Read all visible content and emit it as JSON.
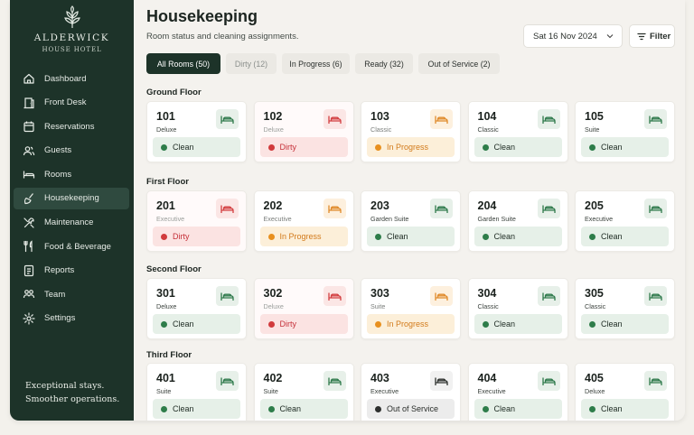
{
  "brand": {
    "name": "ALDERWICK",
    "sub": "HOUSE HOTEL"
  },
  "nav": [
    {
      "label": "Dashboard",
      "icon": "home-icon",
      "active": false
    },
    {
      "label": "Front Desk",
      "icon": "door-icon",
      "active": false
    },
    {
      "label": "Reservations",
      "icon": "calendar-icon",
      "active": false
    },
    {
      "label": "Guests",
      "icon": "users-icon",
      "active": false
    },
    {
      "label": "Rooms",
      "icon": "bed-icon",
      "active": false
    },
    {
      "label": "Housekeeping",
      "icon": "broom-icon",
      "active": true
    },
    {
      "label": "Maintenance",
      "icon": "tools-icon",
      "active": false
    },
    {
      "label": "Food & Beverage",
      "icon": "cutlery-icon",
      "active": false
    },
    {
      "label": "Reports",
      "icon": "report-icon",
      "active": false
    },
    {
      "label": "Team",
      "icon": "team-icon",
      "active": false
    },
    {
      "label": "Settings",
      "icon": "gear-icon",
      "active": false
    }
  ],
  "tagline": {
    "line1": "Exceptional stays.",
    "line2": "Smoother operations."
  },
  "header": {
    "title": "Housekeeping",
    "subtitle": "Room status and cleaning assignments."
  },
  "date_label": "Sat 16 Nov 2024",
  "filter_label": "Filter",
  "tabs": [
    {
      "label": "All Rooms (50)",
      "state": "active"
    },
    {
      "label": "Dirty (12)",
      "state": "muted"
    },
    {
      "label": "In Progress (6)",
      "state": "normal"
    },
    {
      "label": "Ready (32)",
      "state": "normal"
    },
    {
      "label": "Out of Service (2)",
      "state": "normal"
    }
  ],
  "colors": {
    "sidebar": "#1d3329",
    "clean": "#2e7d4a",
    "dirty": "#d13a3c",
    "in_progress": "#e8901f",
    "out_of_service": "#2d2f2e"
  },
  "floors": [
    {
      "name": "Ground Floor",
      "rooms": [
        {
          "number": "101",
          "type": "Deluxe",
          "status": "Clean",
          "kind": "clean"
        },
        {
          "number": "102",
          "type": "Deluxe",
          "status": "Dirty",
          "kind": "dirty"
        },
        {
          "number": "103",
          "type": "Classic",
          "status": "In Progress",
          "kind": "prog"
        },
        {
          "number": "104",
          "type": "Classic",
          "status": "Clean",
          "kind": "clean"
        },
        {
          "number": "105",
          "type": "Suite",
          "status": "Clean",
          "kind": "clean"
        }
      ]
    },
    {
      "name": "First Floor",
      "rooms": [
        {
          "number": "201",
          "type": "Executive",
          "status": "Dirty",
          "kind": "dirty"
        },
        {
          "number": "202",
          "type": "Executive",
          "status": "In Progress",
          "kind": "prog"
        },
        {
          "number": "203",
          "type": "Garden Suite",
          "status": "Clean",
          "kind": "clean"
        },
        {
          "number": "204",
          "type": "Garden Suite",
          "status": "Clean",
          "kind": "clean"
        },
        {
          "number": "205",
          "type": "Executive",
          "status": "Clean",
          "kind": "clean"
        }
      ]
    },
    {
      "name": "Second Floor",
      "rooms": [
        {
          "number": "301",
          "type": "Deluxe",
          "status": "Clean",
          "kind": "clean"
        },
        {
          "number": "302",
          "type": "Deluxe",
          "status": "Dirty",
          "kind": "dirty"
        },
        {
          "number": "303",
          "type": "Suite",
          "status": "In Progress",
          "kind": "prog"
        },
        {
          "number": "304",
          "type": "Classic",
          "status": "Clean",
          "kind": "clean"
        },
        {
          "number": "305",
          "type": "Classic",
          "status": "Clean",
          "kind": "clean"
        }
      ]
    },
    {
      "name": "Third Floor",
      "rooms": [
        {
          "number": "401",
          "type": "Suite",
          "status": "Clean",
          "kind": "clean"
        },
        {
          "number": "402",
          "type": "Suite",
          "status": "Clean",
          "kind": "clean"
        },
        {
          "number": "403",
          "type": "Executive",
          "status": "Out of Service",
          "kind": "oos"
        },
        {
          "number": "404",
          "type": "Executive",
          "status": "Clean",
          "kind": "clean"
        },
        {
          "number": "405",
          "type": "Deluxe",
          "status": "Clean",
          "kind": "clean"
        }
      ]
    }
  ]
}
